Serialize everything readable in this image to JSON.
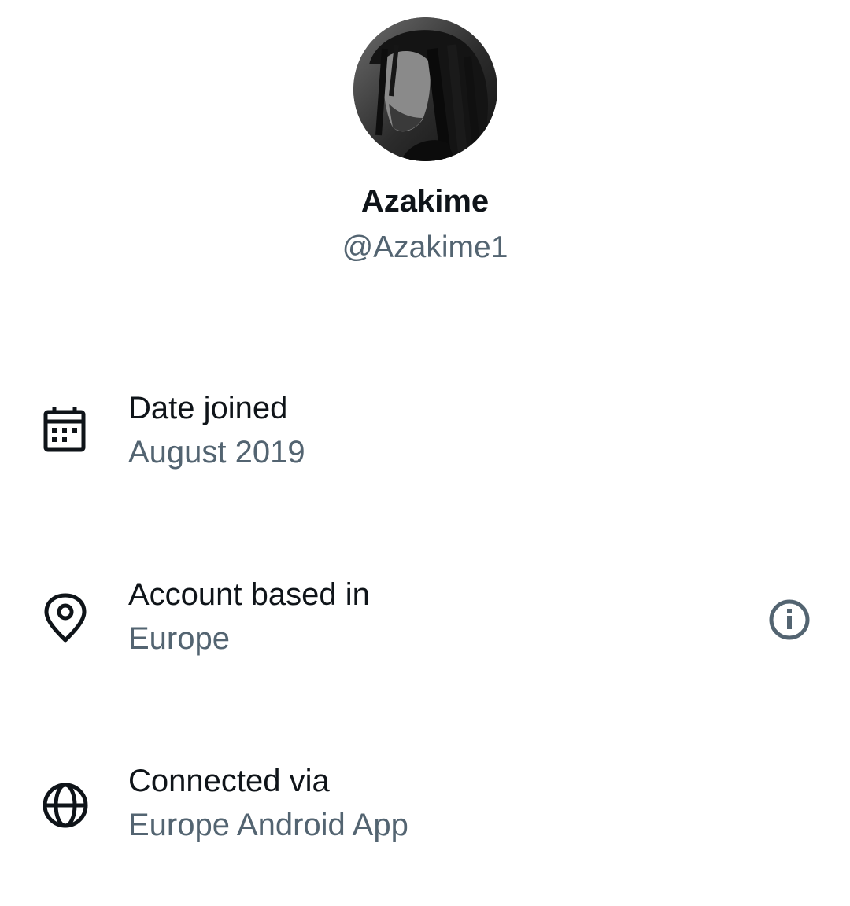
{
  "profile": {
    "display_name": "Azakime",
    "handle": "@Azakime1",
    "avatar_icon": "profile-photo"
  },
  "rows": [
    {
      "label": "Date joined",
      "value": "August 2019",
      "icon": "calendar-icon"
    },
    {
      "label": "Account based in",
      "value": "Europe",
      "icon": "location-pin-icon",
      "action_icon": "info-icon"
    },
    {
      "label": "Connected via",
      "value": "Europe Android App",
      "icon": "globe-icon"
    }
  ],
  "colors": {
    "primary_text": "#0f1419",
    "secondary_text": "#536471",
    "background": "#ffffff"
  }
}
